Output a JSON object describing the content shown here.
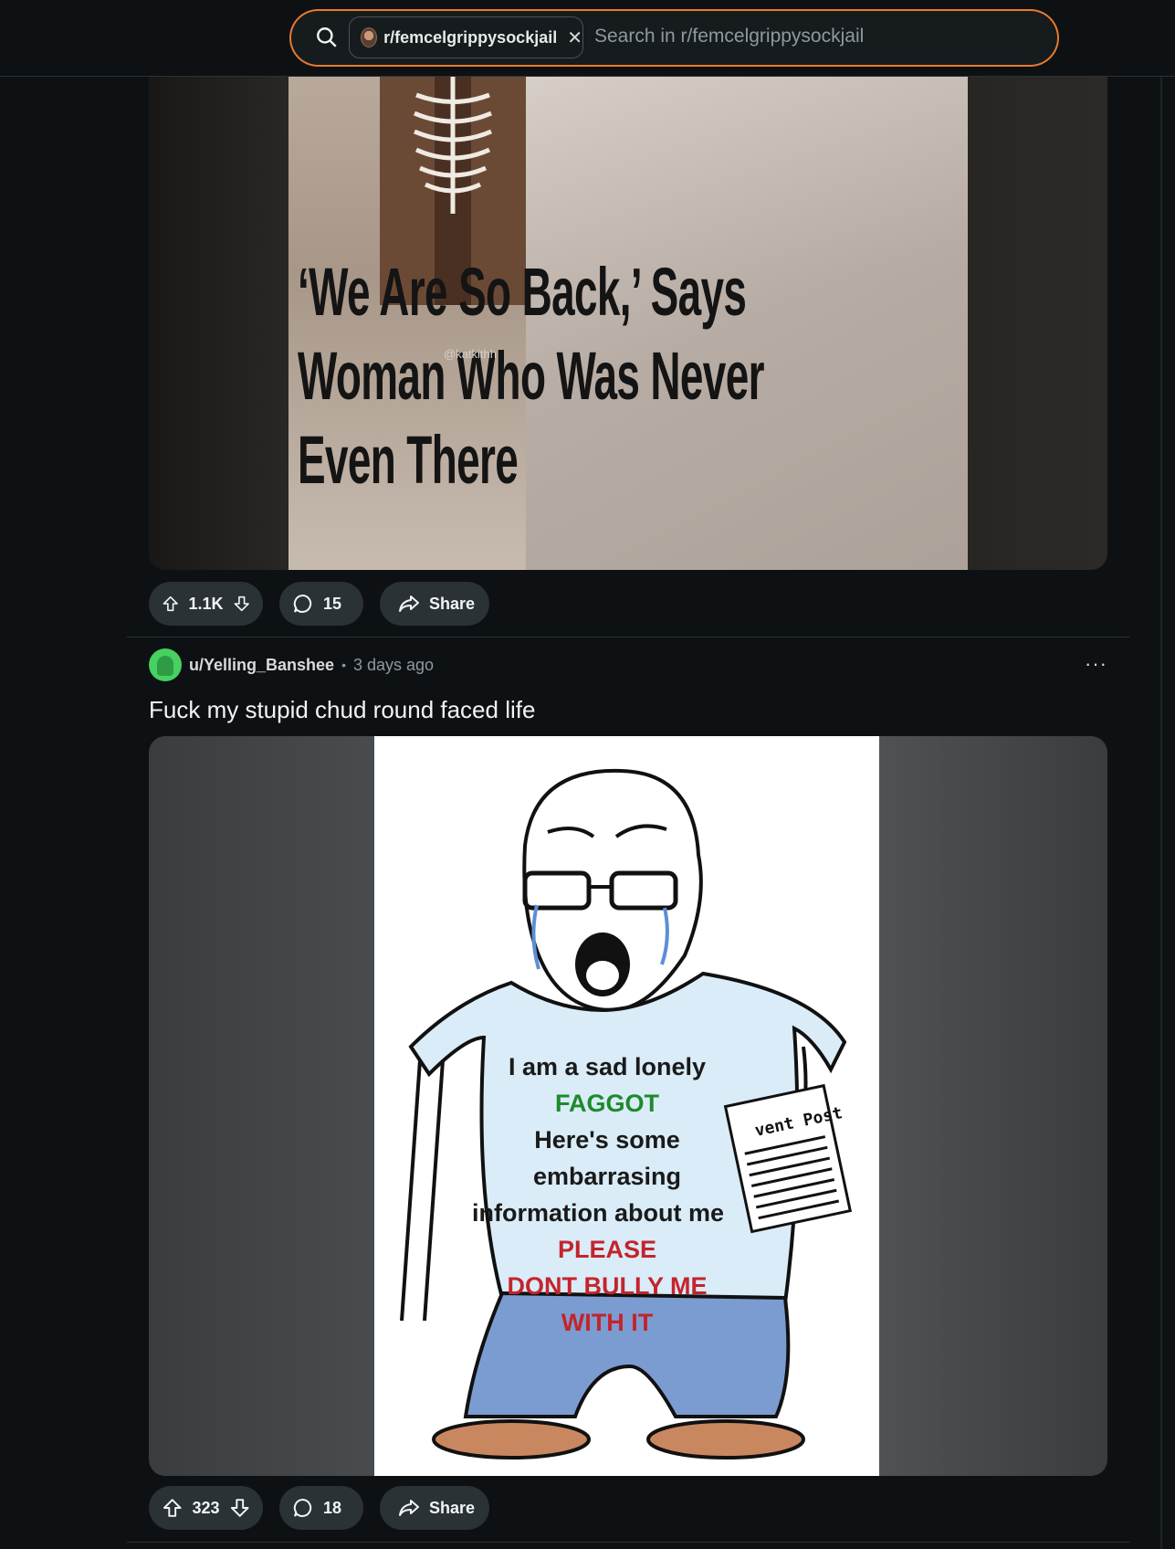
{
  "search": {
    "community_chip": "r/femcelgrippysockjail",
    "placeholder": "Search in r/femcelgrippysockjail"
  },
  "posts": [
    {
      "image_text": {
        "line1": "‘We Are So Back,’ Says",
        "line2": "Woman Who Was Never",
        "line3": "Even There",
        "watermark": "@katkithh"
      },
      "votes": "1.1K",
      "comments": "15",
      "share_label": "Share"
    },
    {
      "author": "u/Yelling_Banshee",
      "separator": "•",
      "time": "3 days ago",
      "more": "···",
      "title": "Fuck my stupid chud round faced life",
      "image_text": {
        "line1": "I am a sad lonely",
        "line2": "FAGGOT",
        "line3": "Here's  some",
        "line4": "embarrasing",
        "line5": "information about me",
        "line6": "PLEASE",
        "line7": "DONT BULLY ME",
        "line8": "WITH IT",
        "paper": "vent Post"
      },
      "votes": "323",
      "comments": "18",
      "share_label": "Share"
    }
  ],
  "colors": {
    "background": "#0e1113",
    "pill": "#2a3236",
    "accent_orange": "#e87a2c",
    "green_text": "#1e8a2a",
    "red_text": "#c4242b"
  }
}
